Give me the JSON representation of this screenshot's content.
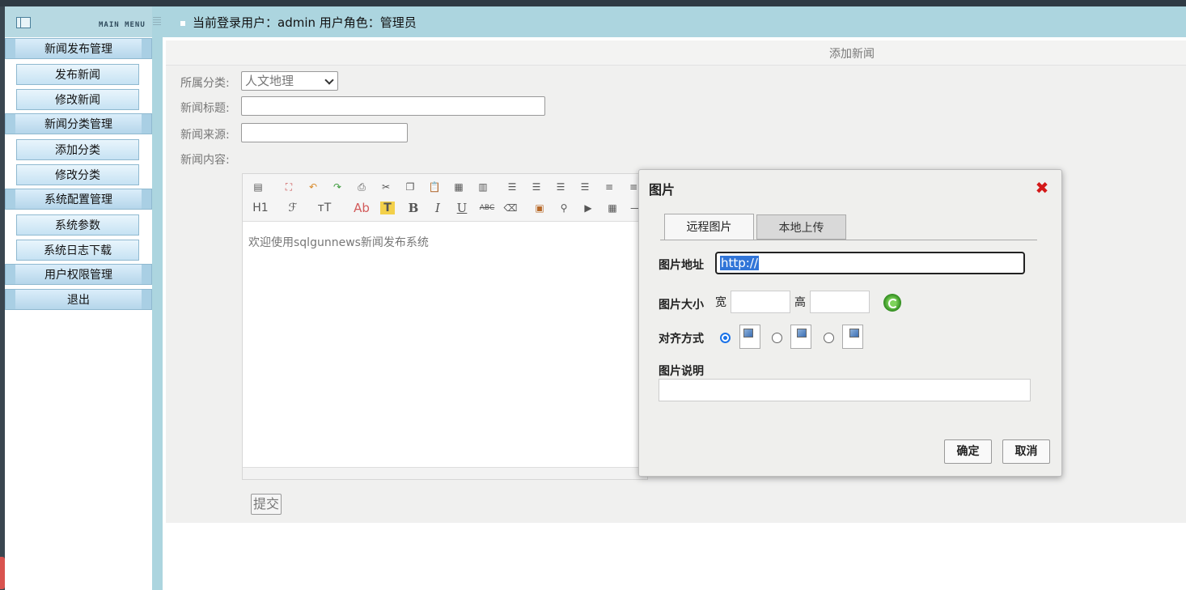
{
  "sidebar": {
    "title": "MAIN MENU",
    "items": [
      {
        "label": "新闻发布管理",
        "type": "group"
      },
      {
        "label": "发布新闻",
        "type": "sub"
      },
      {
        "label": "修改新闻",
        "type": "sub"
      },
      {
        "label": "新闻分类管理",
        "type": "group"
      },
      {
        "label": "添加分类",
        "type": "sub"
      },
      {
        "label": "修改分类",
        "type": "sub"
      },
      {
        "label": "系统配置管理",
        "type": "group"
      },
      {
        "label": "系统参数",
        "type": "sub"
      },
      {
        "label": "系统日志下载",
        "type": "sub"
      },
      {
        "label": "用户权限管理",
        "type": "group"
      },
      {
        "label": "退出",
        "type": "group"
      }
    ]
  },
  "header": {
    "user_info": "当前登录用户：admin 用户角色：管理员"
  },
  "form": {
    "title": "添加新闻",
    "category_label": "所属分类:",
    "category_value": "人文地理",
    "title_label": "新闻标题:",
    "title_value": "",
    "source_label": "新闻来源:",
    "source_value": "",
    "content_label": "新闻内容:",
    "editor_text": "欢迎使用sqlgunnews新闻发布系统",
    "submit_label": "提交",
    "toolbar_row2": {
      "heading": "H1",
      "font_family": "ℱ",
      "font_size": "ᴛT",
      "font_color": "Ab",
      "bg_color": "T",
      "bold": "B",
      "italic": "I",
      "underline": "U",
      "strike": "ABC"
    }
  },
  "dialog": {
    "title": "图片",
    "tabs": [
      "远程图片",
      "本地上传"
    ],
    "url_label": "图片地址",
    "url_value": "http://",
    "size_label": "图片大小",
    "width_label": "宽",
    "height_label": "高",
    "align_label": "对齐方式",
    "desc_label": "图片说明",
    "ok_label": "确定",
    "cancel_label": "取消"
  },
  "colors": {
    "header_bg": "#acd5df",
    "accent_blue": "#1b73e8",
    "close_red": "#d31919"
  }
}
